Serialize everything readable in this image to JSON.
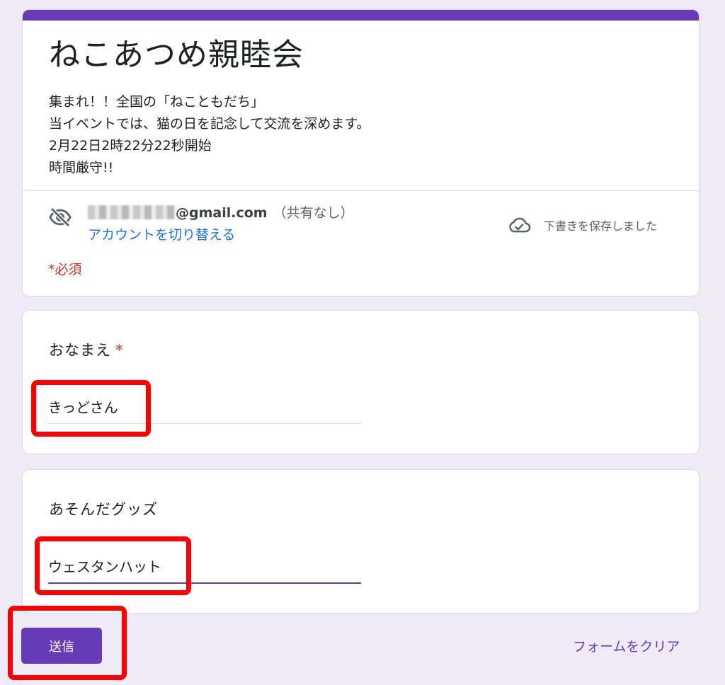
{
  "form": {
    "title": "ねこあつめ親睦会",
    "description": [
      "集まれ！！全国の「ねこともだち」",
      "当イベントでは、猫の日を記念して交流を深めます。",
      "2月22日2時22分22秒開始",
      "時間厳守!!"
    ]
  },
  "account": {
    "email_domain": "@gmail.com",
    "share_status": "（共有なし）",
    "switch_label": "アカウントを切り替える",
    "draft_status": "下書きを保存しました",
    "hidden_icon": "eye-off-icon",
    "cloud_icon": "cloud-check-icon"
  },
  "required_note": "*必須",
  "questions": [
    {
      "label": "おなまえ",
      "required_mark": "*",
      "value": "きっどさん"
    },
    {
      "label": "あそんだグッズ",
      "value": "ウェスタンハット"
    }
  ],
  "actions": {
    "submit_label": "送信",
    "clear_label": "フォームをクリア"
  },
  "colors": {
    "accent": "#673ab7",
    "background": "#efebf6",
    "required": "#d93025",
    "link": "#1a73e8",
    "highlight_box": "#ff0000"
  }
}
